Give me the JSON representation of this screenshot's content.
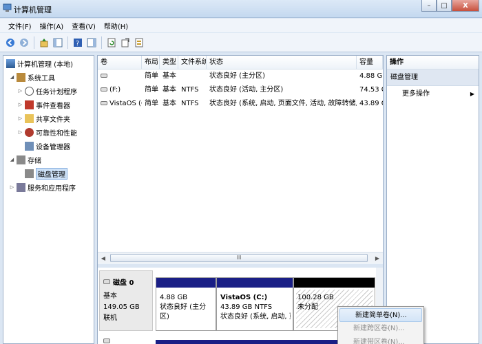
{
  "window": {
    "title": "计算机管理",
    "minimize": "–",
    "maximize": "□",
    "close": "X"
  },
  "menu": [
    "文件(F)",
    "操作(A)",
    "查看(V)",
    "帮助(H)"
  ],
  "toolbar": {
    "icons": [
      "back-icon",
      "forward-icon",
      "up-icon",
      "console-tree-icon",
      "help-icon",
      "properties-icon",
      "refresh-icon",
      "export-icon",
      "help-topics-icon"
    ]
  },
  "tree": {
    "root": "计算机管理 (本地)",
    "system_tools": "系统工具",
    "task_scheduler": "任务计划程序",
    "event_viewer": "事件查看器",
    "shared_folders": "共享文件夹",
    "reliability": "可靠性和性能",
    "device_manager": "设备管理器",
    "storage": "存储",
    "disk_management": "磁盘管理",
    "services_apps": "服务和应用程序"
  },
  "volume_table": {
    "headers": [
      "卷",
      "布局",
      "类型",
      "文件系统",
      "状态",
      "容量"
    ],
    "rows": [
      {
        "volume": "",
        "layout": "简单",
        "type": "基本",
        "fs": "",
        "status": "状态良好 (主分区)",
        "capacity": "4.88 GB"
      },
      {
        "volume": "(F:)",
        "layout": "简单",
        "type": "基本",
        "fs": "NTFS",
        "status": "状态良好 (活动, 主分区)",
        "capacity": "74.53 GB"
      },
      {
        "volume": "VistaOS (C:)",
        "layout": "简单",
        "type": "基本",
        "fs": "NTFS",
        "status": "状态良好 (系统, 启动, 页面文件, 活动, 故障转储, 主分区)",
        "capacity": "43.89 GB"
      }
    ]
  },
  "disk0": {
    "name": "磁盘 0",
    "type": "基本",
    "size": "149.05 GB",
    "state": "联机",
    "partitions": [
      {
        "name": "",
        "size": "4.88 GB",
        "status": "状态良好 (主分区)"
      },
      {
        "name": "VistaOS  (C:)",
        "size": "43.89 GB NTFS",
        "status": "状态良好 (系统, 启动, 页面"
      },
      {
        "name": "",
        "size": "100.28 GB",
        "status": "未分配"
      }
    ]
  },
  "actions": {
    "title": "操作",
    "section": "磁盘管理",
    "more": "更多操作"
  },
  "context_menu": {
    "items": [
      "新建简单卷(N)...",
      "新建跨区卷(N)...",
      "新建带区卷(N)..."
    ]
  },
  "scroll_glyph": "III"
}
